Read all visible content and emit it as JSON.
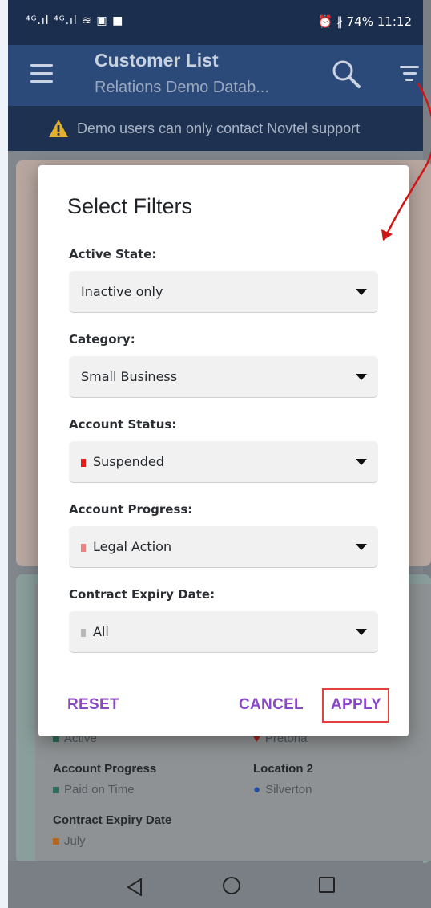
{
  "status_bar": {
    "left": "⁴ᴳ.ıl ⁴ᴳ.ıl ≋ ▣ ■",
    "battery": "⏰ ∦ 74%",
    "time": "11:12"
  },
  "app_bar": {
    "title": "Customer List",
    "subtitle": "Relations Demo Datab...",
    "icons": [
      "menu-icon",
      "search-icon",
      "filter-icon"
    ]
  },
  "warning": {
    "text": "Demo users can only contact Novtel support",
    "icon": "warning-icon"
  },
  "background_card": {
    "status_value": "Active",
    "location_value": "Pretoria",
    "account_progress_label": "Account Progress",
    "account_progress_value": "Paid on Time",
    "location2_label": "Location 2",
    "location2_value": "Silverton",
    "contract_label": "Contract Expiry Date",
    "contract_value": "July"
  },
  "dialog": {
    "title": "Select Filters",
    "fields": [
      {
        "label": "Active State:",
        "value": "Inactive only",
        "color": ""
      },
      {
        "label": "Category:",
        "value": "Small Business",
        "color": ""
      },
      {
        "label": "Account Status:",
        "value": "Suspended",
        "color": "#e81919"
      },
      {
        "label": "Account Progress:",
        "value": "Legal Action",
        "color": "#ef8080"
      },
      {
        "label": "Contract Expiry Date:",
        "value": "All",
        "color": "#b9b9b9"
      }
    ],
    "buttons": {
      "reset": "RESET",
      "cancel": "CANCEL",
      "apply": "APPLY"
    }
  },
  "colors": {
    "accent": "#8a48c9",
    "app_bar": "#2c4a79",
    "highlight": "#e34040"
  }
}
